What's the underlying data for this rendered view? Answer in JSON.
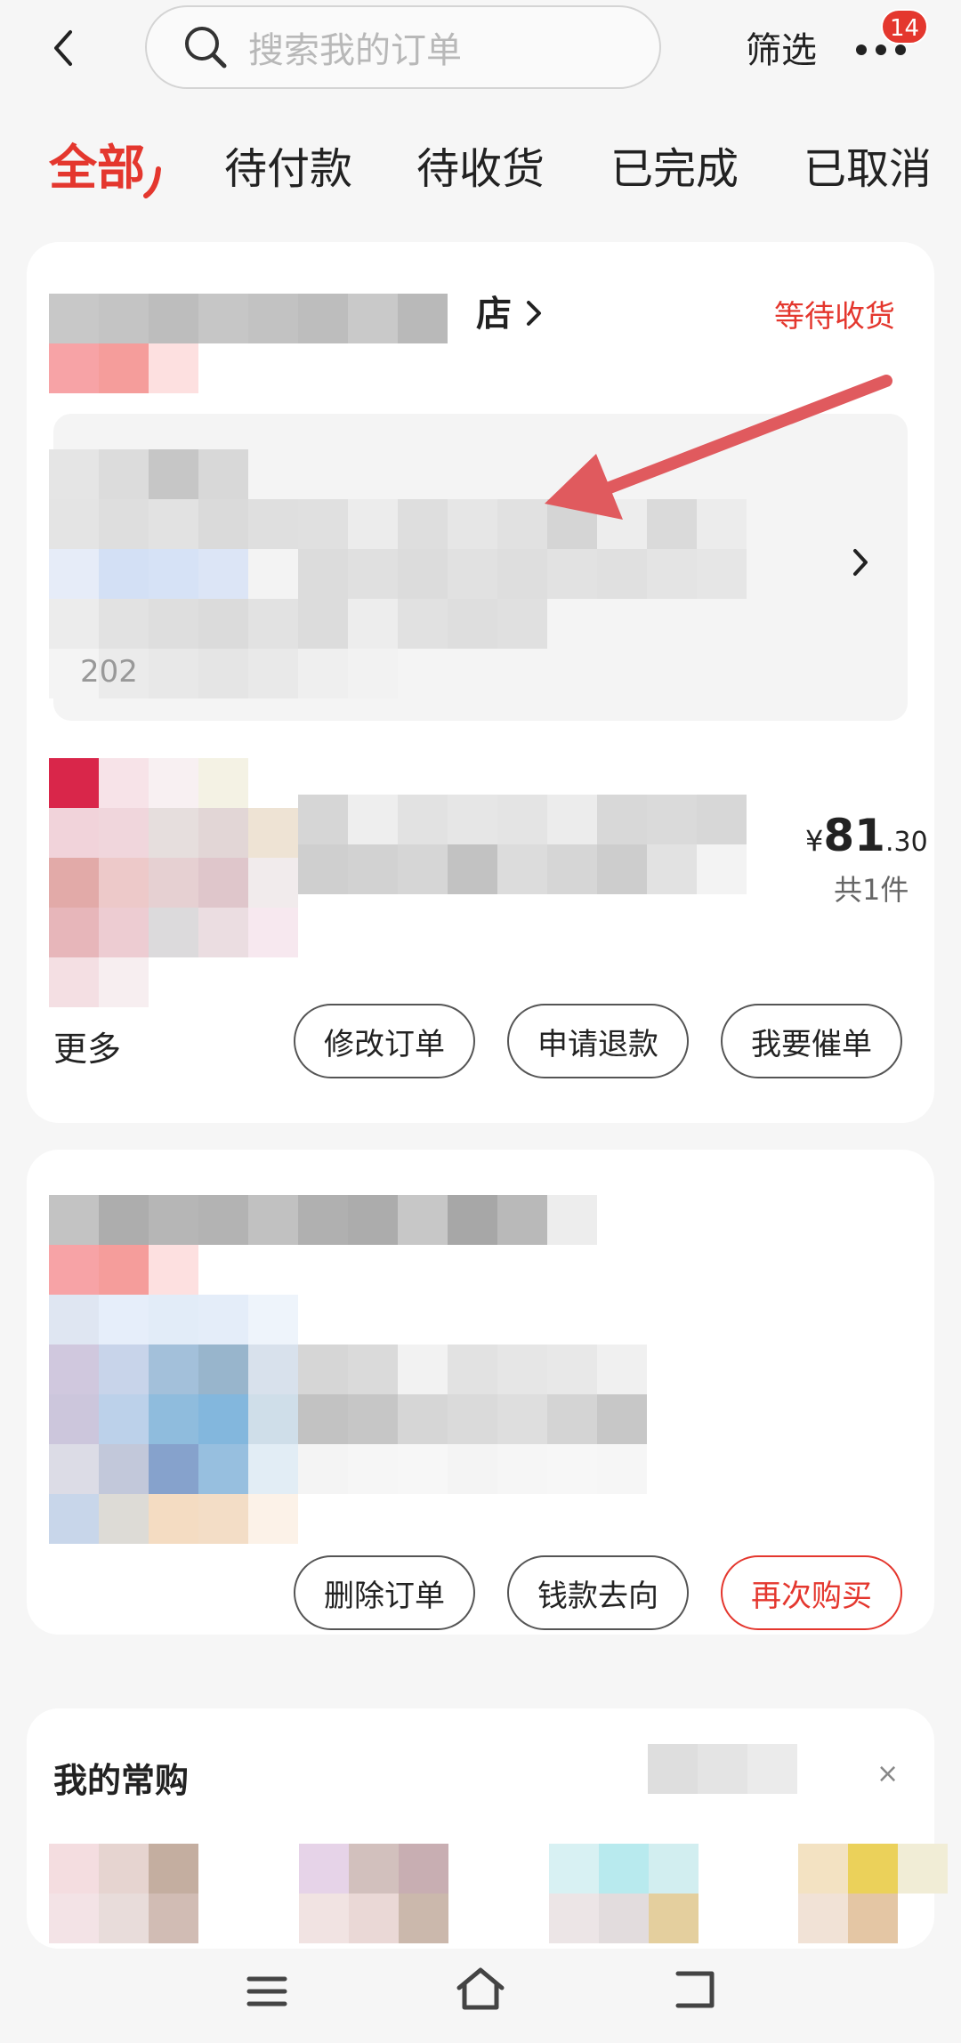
{
  "header": {
    "search_placeholder": "搜索我的订单",
    "filter_label": "筛选",
    "more_badge": "14"
  },
  "tabs": [
    {
      "label": "全部",
      "active": true
    },
    {
      "label": "待付款",
      "active": false
    },
    {
      "label": "待收货",
      "active": false
    },
    {
      "label": "已完成",
      "active": false
    },
    {
      "label": "已取消",
      "active": false
    }
  ],
  "order1": {
    "store_suffix": "店",
    "status": "等待收货",
    "logistics_date_prefix": "202",
    "price": {
      "currency": "¥",
      "integer": "81",
      "decimal": ".30"
    },
    "quantity": "共1件",
    "more_label": "更多",
    "buttons": [
      "修改订单",
      "申请退款",
      "我要催单"
    ]
  },
  "order2": {
    "buttons": [
      "删除订单",
      "钱款去向",
      "再次购买"
    ]
  },
  "frequent": {
    "title": "我的常购",
    "close": "×"
  },
  "colors": {
    "accent": "#e4372e",
    "background": "#f6f6f6",
    "card": "#ffffff"
  }
}
